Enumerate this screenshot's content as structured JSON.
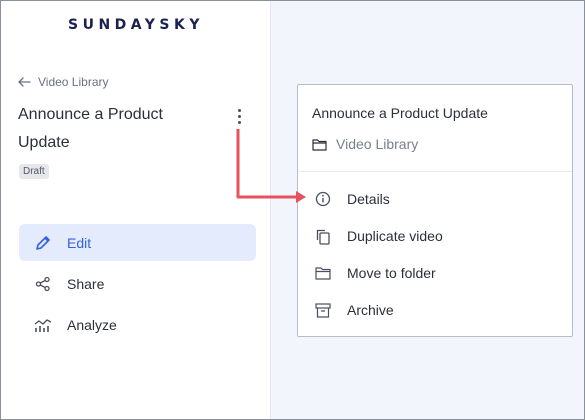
{
  "brand": {
    "logo_text": "SUNDAYSKY"
  },
  "header": {
    "back_label": "Video Library",
    "video_title": "Announce a Product Update",
    "status_badge": "Draft"
  },
  "nav": {
    "items": [
      {
        "label": "Edit",
        "icon": "pencil-icon",
        "active": true
      },
      {
        "label": "Share",
        "icon": "share-icon",
        "active": false
      },
      {
        "label": "Analyze",
        "icon": "analytics-icon",
        "active": false
      }
    ]
  },
  "menu": {
    "title": "Announce a Product Update",
    "folder": "Video Library",
    "items": [
      {
        "label": "Details",
        "icon": "info-icon"
      },
      {
        "label": "Duplicate video",
        "icon": "duplicate-icon"
      },
      {
        "label": "Move to folder",
        "icon": "folder-icon"
      },
      {
        "label": "Archive",
        "icon": "archive-icon"
      }
    ]
  },
  "colors": {
    "brand_navy": "#1c2150",
    "accent_blue": "#3561e0",
    "active_bg": "#e4ebfc",
    "annotation_arrow": "#e8505b",
    "right_pane_bg": "#f3f5fc"
  }
}
